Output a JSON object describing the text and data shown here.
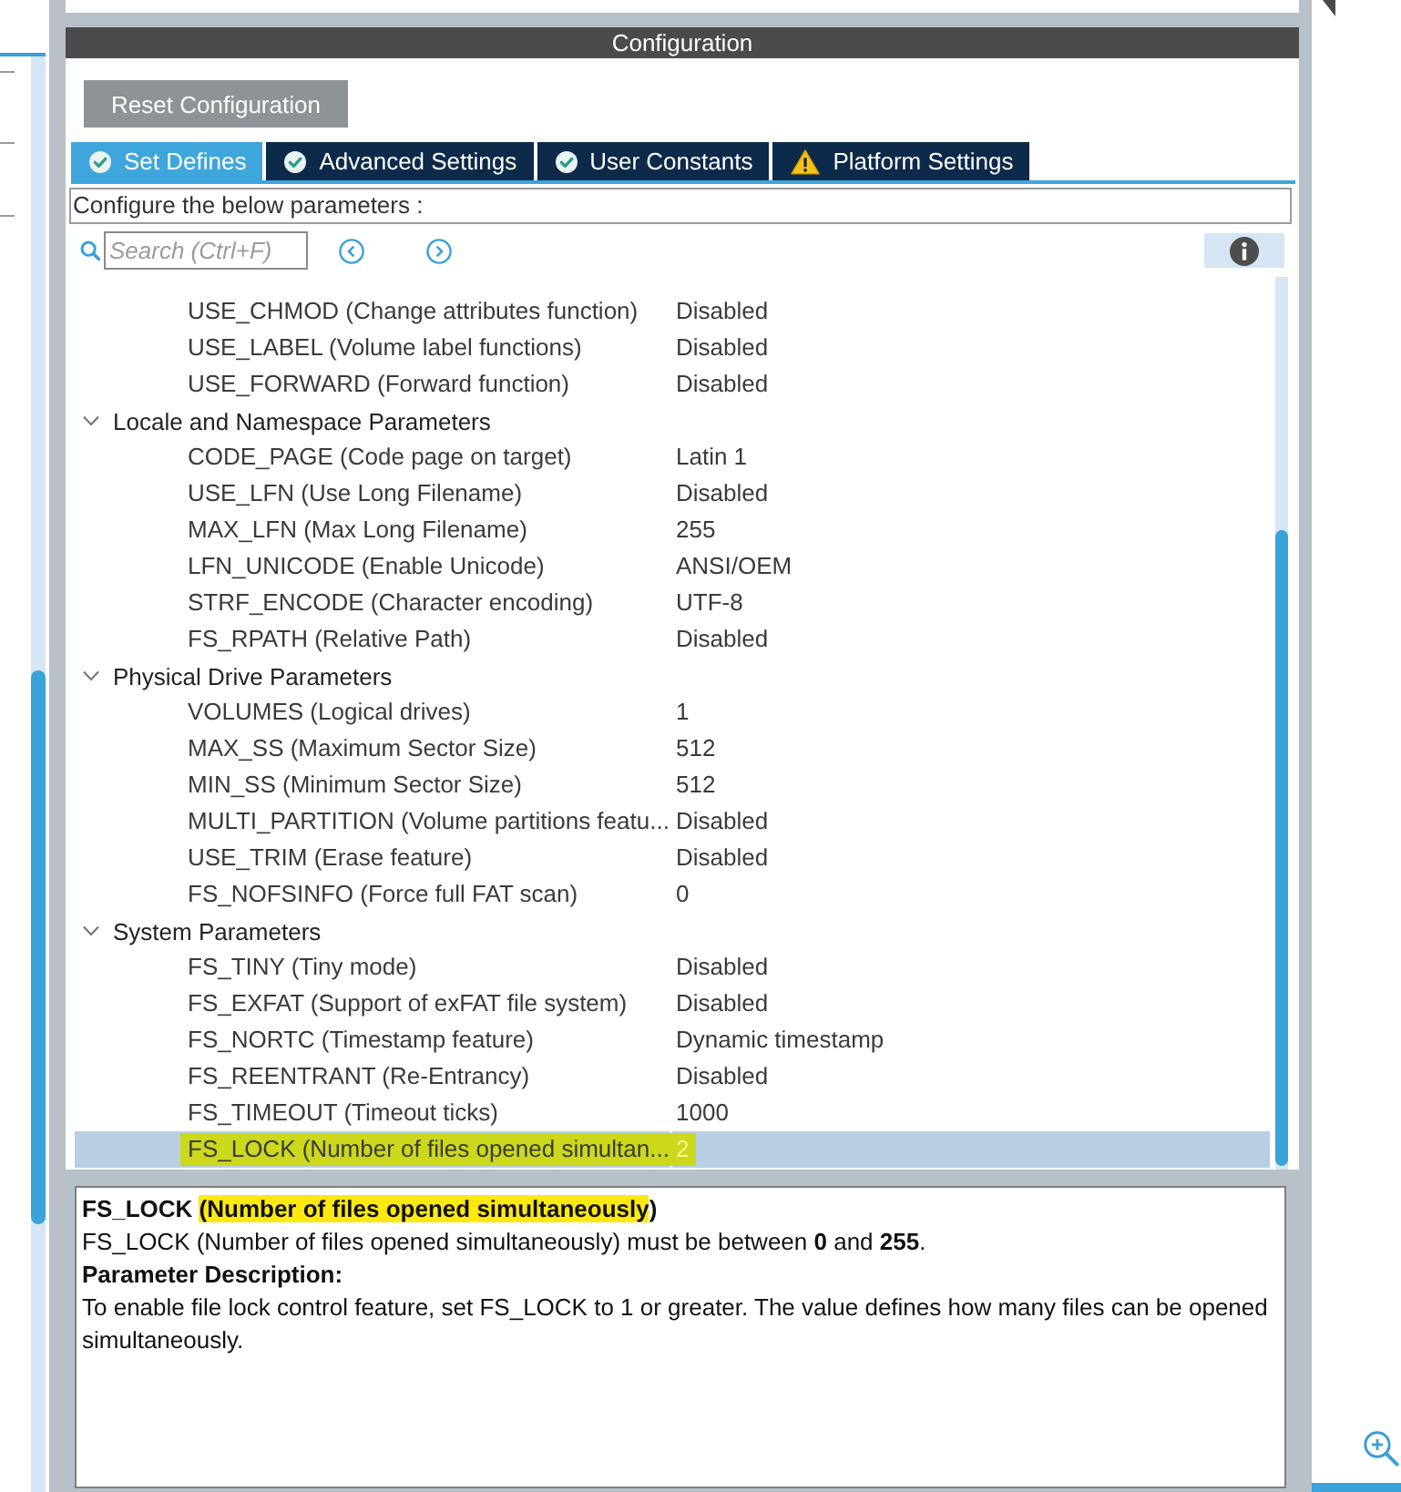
{
  "panel": {
    "title": "Configuration"
  },
  "reset_button": {
    "label": "Reset Configuration"
  },
  "tabs": [
    {
      "label": "Set Defines",
      "kind": "check",
      "selected": true
    },
    {
      "label": "Advanced Settings",
      "kind": "check",
      "selected": false
    },
    {
      "label": "User Constants",
      "kind": "check",
      "selected": false
    },
    {
      "label": "Platform Settings",
      "kind": "warning",
      "selected": false
    }
  ],
  "instructions": "Configure the below parameters :",
  "search": {
    "placeholder": "Search (Ctrl+F)"
  },
  "parameters": {
    "items_above": [
      {
        "name": "USE_CHMOD (Change attributes function)",
        "value": "Disabled",
        "selected": false,
        "highlighted": false
      },
      {
        "name": "USE_LABEL (Volume label functions)",
        "value": "Disabled",
        "selected": false,
        "highlighted": false
      },
      {
        "name": "USE_FORWARD (Forward function)",
        "value": "Disabled",
        "selected": false,
        "highlighted": false
      }
    ],
    "groups": [
      {
        "label": "Locale and Namespace Parameters",
        "expanded": true,
        "children": [
          {
            "name": "CODE_PAGE (Code page on target)",
            "value": "Latin 1",
            "selected": false,
            "highlighted": false
          },
          {
            "name": "USE_LFN (Use Long Filename)",
            "value": "Disabled",
            "selected": false,
            "highlighted": false
          },
          {
            "name": "MAX_LFN (Max Long Filename)",
            "value": "255",
            "selected": false,
            "highlighted": false
          },
          {
            "name": "LFN_UNICODE (Enable Unicode)",
            "value": "ANSI/OEM",
            "selected": false,
            "highlighted": false
          },
          {
            "name": "STRF_ENCODE (Character encoding)",
            "value": "UTF-8",
            "selected": false,
            "highlighted": false
          },
          {
            "name": "FS_RPATH (Relative Path)",
            "value": "Disabled",
            "selected": false,
            "highlighted": false
          }
        ]
      },
      {
        "label": "Physical Drive Parameters",
        "expanded": true,
        "children": [
          {
            "name": "VOLUMES (Logical drives)",
            "value": "1",
            "selected": false,
            "highlighted": false
          },
          {
            "name": "MAX_SS (Maximum Sector Size)",
            "value": "512",
            "selected": false,
            "highlighted": false
          },
          {
            "name": "MIN_SS (Minimum Sector Size)",
            "value": "512",
            "selected": false,
            "highlighted": false
          },
          {
            "name": "MULTI_PARTITION (Volume partitions featu...",
            "value": "Disabled",
            "selected": false,
            "highlighted": false
          },
          {
            "name": "USE_TRIM (Erase feature)",
            "value": "Disabled",
            "selected": false,
            "highlighted": false
          },
          {
            "name": "FS_NOFSINFO (Force full FAT scan)",
            "value": "0",
            "selected": false,
            "highlighted": false
          }
        ]
      },
      {
        "label": "System Parameters",
        "expanded": true,
        "children": [
          {
            "name": "FS_TINY (Tiny mode)",
            "value": "Disabled",
            "selected": false,
            "highlighted": false
          },
          {
            "name": "FS_EXFAT (Support of exFAT file system)",
            "value": "Disabled",
            "selected": false,
            "highlighted": false
          },
          {
            "name": "FS_NORTC (Timestamp feature)",
            "value": "Dynamic timestamp",
            "selected": false,
            "highlighted": false
          },
          {
            "name": "FS_REENTRANT (Re-Entrancy)",
            "value": "Disabled",
            "selected": false,
            "highlighted": false
          },
          {
            "name": "FS_TIMEOUT (Timeout ticks)",
            "value": "1000",
            "selected": false,
            "highlighted": false
          },
          {
            "name": "FS_LOCK (Number of files opened simultan...",
            "value": "2",
            "selected": true,
            "highlighted": true
          }
        ]
      }
    ]
  },
  "description": {
    "title_parts": [
      {
        "text": "FS_LOCK ",
        "highlighted": false
      },
      {
        "text": "(Number of files opened simultaneously",
        "highlighted": true
      },
      {
        "text": ")",
        "highlighted": false
      }
    ],
    "range_text": "FS_LOCK (Number of files opened simultaneously) must be between **0** and **255**.",
    "heading": "Parameter Description:",
    "body": "To enable file lock control feature, set FS_LOCK to 1 or greater. The value defines how many files can be opened simultaneously."
  }
}
